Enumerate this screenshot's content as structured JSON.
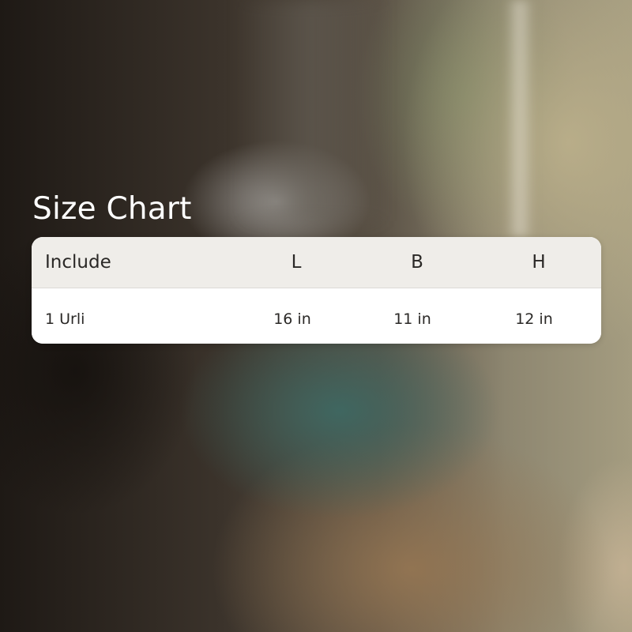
{
  "title": "Size Chart",
  "table": {
    "headers": [
      "Include",
      "L",
      "B",
      "H"
    ],
    "rows": [
      [
        "1 Urli",
        "16 in",
        "11 in",
        "12 in"
      ]
    ]
  },
  "colors": {
    "title_text": "#ffffff",
    "header_bg": "#efede9",
    "body_bg": "#ffffff",
    "cell_text": "#2a2826"
  }
}
